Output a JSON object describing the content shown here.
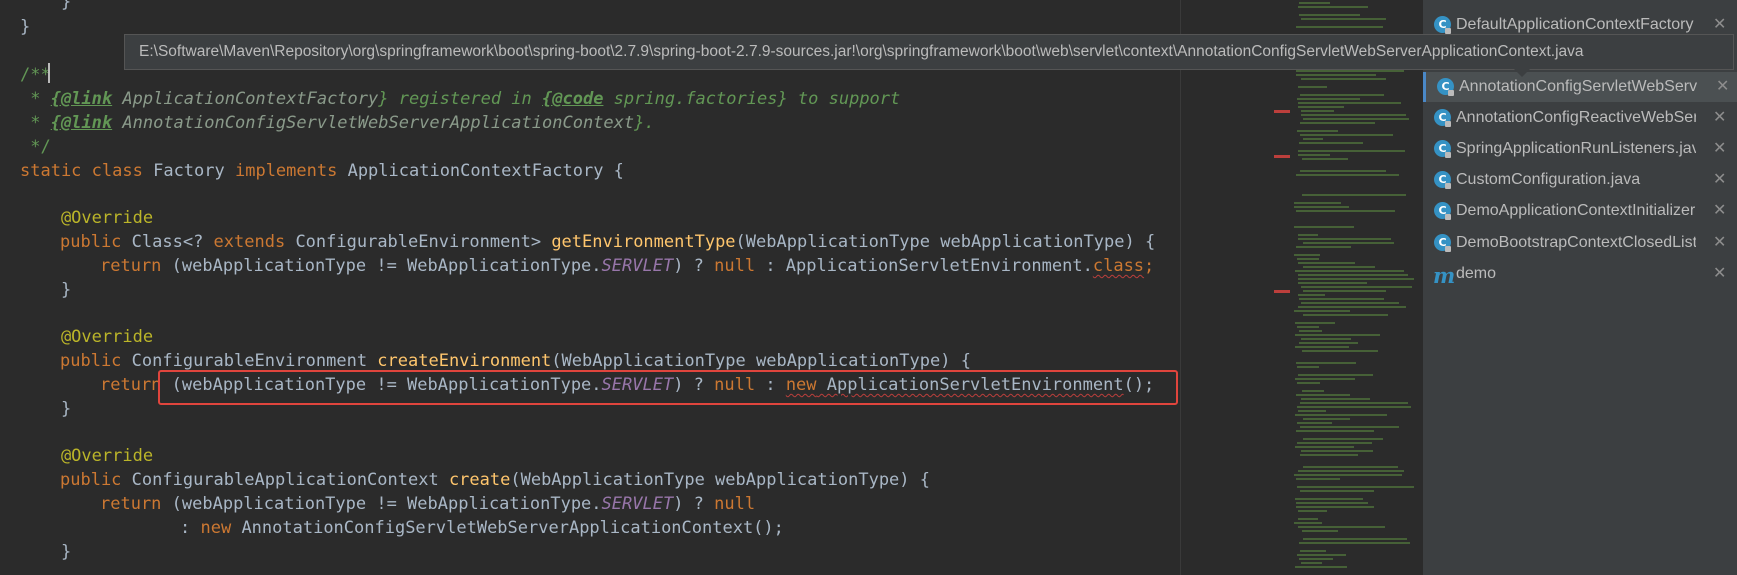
{
  "editor": {
    "lines": [
      {
        "t": "    }"
      },
      {
        "t": "}"
      },
      {
        "t": "/**"
      },
      {
        "t1": " * ",
        "link1": "{@link",
        "ref1": " ApplicationContextFactory",
        "t2": "} registered in ",
        "code": "{@code",
        "ref2": " spring.factories",
        "t3": "} to support"
      },
      {
        "t1": " * ",
        "link1": "{@link",
        "ref1": " AnnotationConfigServletWebServerApplicationContext",
        "t2": "}."
      },
      {
        "t": " */"
      },
      {
        "static": "static",
        "class": "class",
        "name": " Factory ",
        "impl": "implements",
        "iface": " ApplicationContextFactory {"
      },
      {
        "t": "    @Override"
      },
      {
        "pub": "public",
        "rest": " Class<? ",
        "ext": "extends",
        "type": " ConfigurableEnvironment> ",
        "fn": "getEnvironmentType",
        "args": "(WebApplicationType webApplicationType) {"
      },
      {
        "ret": "return",
        "a": " (webApplicationType != WebApplicationType.",
        "c": "SERVLET",
        "b": ") ? ",
        "nul": "null",
        "d": " : ApplicationServletEnvironment.",
        "cls": "class",
        "e": ";"
      },
      {
        "t": "    }"
      },
      {
        "t": "    @Override"
      },
      {
        "pub": "public",
        "type": " ConfigurableEnvironment ",
        "fn": "createEnvironment",
        "args": "(WebApplicationType webApplicationType) {"
      },
      {
        "ret": "return",
        "a": " (webApplicationType != WebApplicationType.",
        "c": "SERVLET",
        "b": ") ? ",
        "nul": "null",
        "d": " : ",
        "nw": "new",
        "e": " ApplicationServletEnvironment",
        "f": "();"
      },
      {
        "t": "    }"
      },
      {
        "t": "    @Override"
      },
      {
        "pub": "public",
        "type": " ConfigurableApplicationContext ",
        "fn": "create",
        "args": "(WebApplicationType webApplicationType) {"
      },
      {
        "ret": "return",
        "a": " (webApplicationType != WebApplicationType.",
        "c": "SERVLET",
        "b": ") ? ",
        "nul": "null"
      },
      {
        "col": ": ",
        "nw": "new",
        "e": " AnnotationConfigServletWebServerApplicationContext();"
      },
      {
        "t": "    }"
      }
    ]
  },
  "tooltip": {
    "path": "E:\\Software\\Maven\\Repository\\org\\springframework\\boot\\spring-boot\\2.7.9\\spring-boot-2.7.9-sources.jar!\\org\\springframework\\boot\\web\\servlet\\context\\AnnotationConfigServletWebServerApplicationContext.java"
  },
  "recent_files": {
    "items": [
      {
        "label": "DefaultApplicationContextFactory",
        "icon": "class-icon"
      },
      {
        "label": "AnnotationConfigServletWebServ",
        "icon": "class-icon",
        "selected": true
      },
      {
        "label": "AnnotationConfigReactiveWebSer",
        "icon": "class-icon"
      },
      {
        "label": "SpringApplicationRunListeners.jav",
        "icon": "class-icon"
      },
      {
        "label": "CustomConfiguration.java",
        "icon": "class-icon"
      },
      {
        "label": "DemoApplicationContextInitializer",
        "icon": "class-icon"
      },
      {
        "label": "DemoBootstrapContextClosedList",
        "icon": "class-icon"
      },
      {
        "label": "demo",
        "icon": "module-icon"
      }
    ],
    "class_glyph": "C",
    "module_glyph": "m",
    "close_glyph": "✕"
  }
}
